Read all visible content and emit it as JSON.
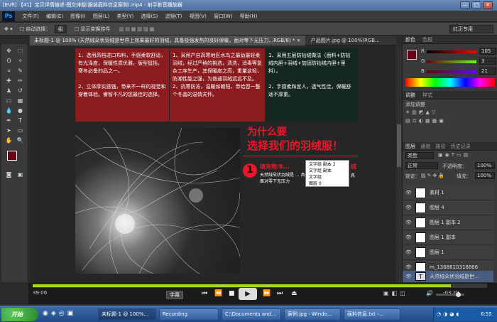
{
  "window": {
    "title": "[EVR] 【41】宝贝详情描述-图文排版(服装面料信息案例).mp4 - 射手影音播放器",
    "min_glyph": "—",
    "max_glyph": "□",
    "close_glyph": "✕"
  },
  "menu": {
    "logo": "Ps",
    "items": [
      "文件(F)",
      "编辑(E)",
      "图像(I)",
      "图层(L)",
      "类型(Y)",
      "选择(S)",
      "滤镜(T)",
      "视图(V)",
      "窗口(W)",
      "帮助(H)"
    ]
  },
  "options": {
    "auto_select_label": "自动选择：",
    "auto_select_value": "组",
    "show_transform": "显示变换控件",
    "workspace": "红正专用"
  },
  "doc_tabs": [
    {
      "label": "未标题-1 @ 100% (天然绒朵状羽绒是世界上效果最好的羽绒，具备极强发热的良好保暖，面对零下无压力...RGB/8) *  ×",
      "active": true
    },
    {
      "label": "产品图片.jpg @ 100%(RGB...",
      "active": false
    }
  ],
  "canvas": {
    "box1": "1、选用高档进口布料，手感柔软舒适，有光泽度，保暖性质优雅。版型挺括，寒冬必备的品之一。\n\n2、立体厚实感强，带来不一样的视觉和穿着体验。睿智不凡的您最佳的选择。",
    "box2": "1、采用产自高寒地区水鸟之最幼最轻柔羽绒，经过严格的挑选，清洗，消毒等复杂工序生产，其保暖度之高，重量这轻，防潮性能之强，为普通羽绒远远不及。\n2、抗寒防冻，温暖如朝阳，带给您一整个冬晶的温情关怀。",
    "box3": "1、采用五层防钻绒做法（面料+防钻绒内胆+羽绒+加固防钻绒内胆+里料）。\n\n2、手感柔和宜人，透气性佳，保暖舒适不厚重。",
    "headline_1": "为什么要",
    "headline_2": "选择我们的羽绒服！",
    "step_num": "1",
    "step_title": "填充物/8...",
    "step_title_tail": "绒",
    "step_body": "天然绒朵状羽绒是 ... 具备吸发散的良好保暖，面对零下无压力",
    "step_body_tail": "具"
  },
  "context_menu": [
    "文字组 副本 2",
    "文字组 副本",
    "文字组",
    "图层 0"
  ],
  "panels": {
    "color_tab": "颜色",
    "swatch_tab": "色板",
    "R": "R",
    "G": "G",
    "B": "B",
    "r_val": "105",
    "g_val": "3",
    "b_val": "21",
    "adjust_tab": "调整",
    "style_tab": "样式",
    "add_adjust": "添加调整",
    "layers_tabs": [
      "图层",
      "通道",
      "路径",
      "历史记录"
    ],
    "kind_label": "类型",
    "blend_mode": "正常",
    "opacity_label": "不透明度：",
    "opacity_val": "100%",
    "lock_label": "锁定：",
    "fill_label": "填充：",
    "fill_val": "100%",
    "layers": [
      {
        "name": "素材 1",
        "selected": false
      },
      {
        "name": "图层 4",
        "selected": false
      },
      {
        "name": "图层 1 副本 2",
        "selected": false
      },
      {
        "name": "图层 1 副本",
        "selected": false
      },
      {
        "name": "图层 1",
        "selected": false
      },
      {
        "name": "m_1368610318866",
        "selected": false
      },
      {
        "name": "天然绒朵状羽绒是世...",
        "selected": true
      }
    ]
  },
  "player": {
    "time_elapsed": "39:06",
    "time_remaining": "-03:29",
    "progress": 0.92,
    "subtitle_btn": "字幕"
  },
  "taskbar": {
    "start": "开始",
    "items": [
      "未标题-1 @ 100%...",
      "Recording",
      "C:\\Documents and...",
      "案例.jpg - Windo...",
      "面料信息.txt -..."
    ],
    "clock": "6:55"
  },
  "colors": {
    "box_red": "#8b1b1e",
    "box_dark": "#15281f",
    "headline_red": "#e8192c",
    "accent_green": "#a8d81e"
  }
}
